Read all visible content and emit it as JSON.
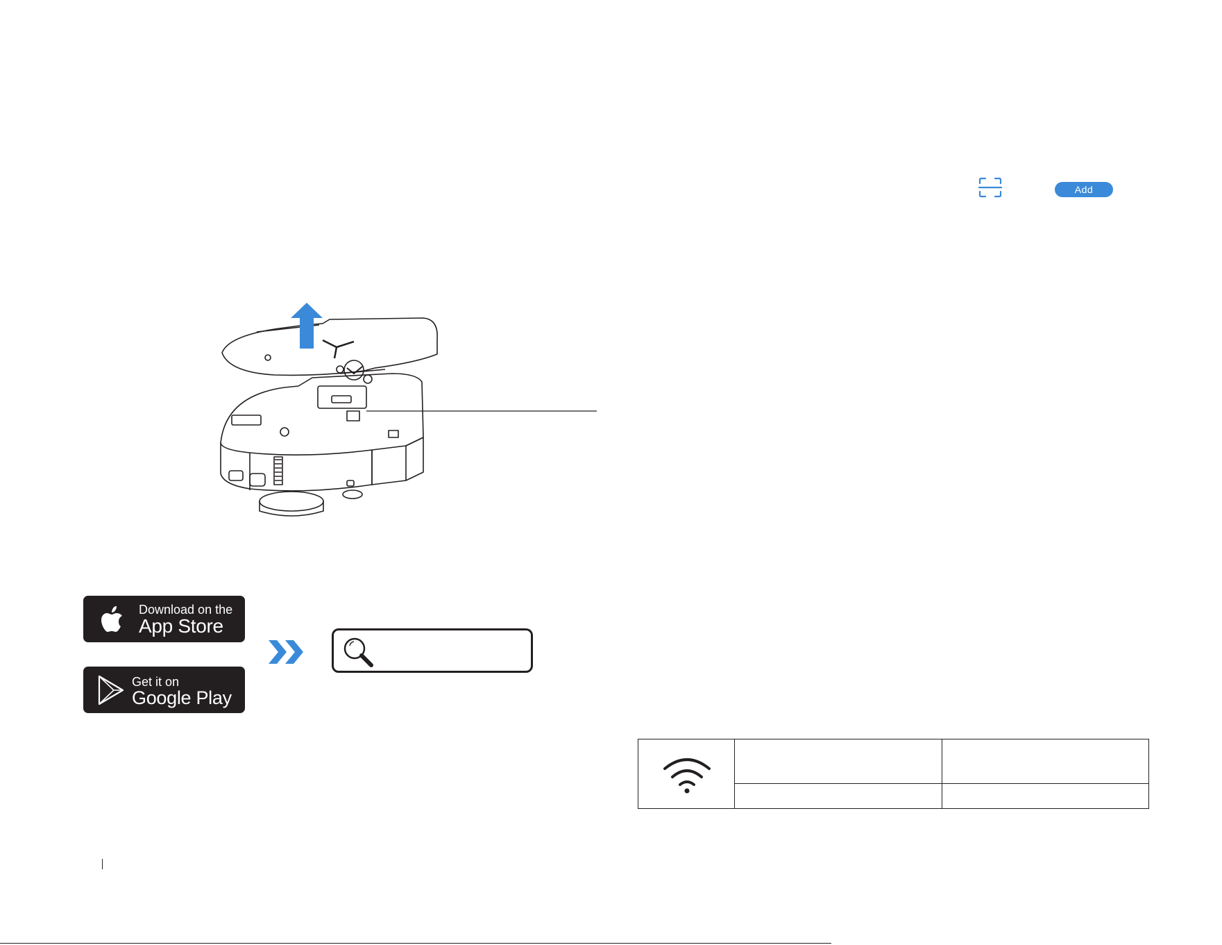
{
  "app_screen": {
    "add_button_label": "Add",
    "scan_icon": "qr-scan-icon"
  },
  "badges": {
    "app_store": {
      "line1": "Download on the",
      "line2": "App Store",
      "icon": "apple-logo-icon"
    },
    "google_play": {
      "line1": "Get it on",
      "line2": "Google Play",
      "icon": "google-play-logo-icon"
    }
  },
  "search": {
    "icon": "search-icon",
    "text": ""
  },
  "colors": {
    "accent": "#3a8ad9",
    "ink": "#231f20",
    "badge_bg": "#231f20"
  },
  "wifi_table": {
    "icon": "wifi-icon"
  }
}
